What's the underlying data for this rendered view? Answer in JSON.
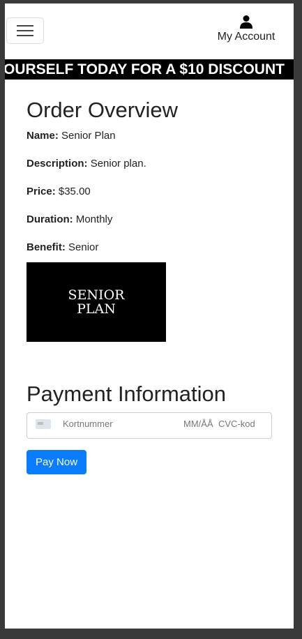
{
  "header": {
    "account_label": "My Account",
    "ticker_text": "OURSELF TODAY FOR A $10 DISCOUNT"
  },
  "order": {
    "title": "Order Overview",
    "fields": [
      {
        "label": "Name:",
        "value": "Senior Plan"
      },
      {
        "label": "Description:",
        "value": "Senior plan."
      },
      {
        "label": "Price:",
        "value": "$35.00"
      },
      {
        "label": "Duration:",
        "value": "Monthly"
      },
      {
        "label": "Benefit:",
        "value": "Senior"
      }
    ],
    "image_text_line1": "SENIOR",
    "image_text_line2": "PLAN"
  },
  "payment": {
    "title": "Payment Information",
    "card_number_placeholder": "Kortnummer",
    "expiry_placeholder": "MM/ÅÅ",
    "cvc_placeholder": "CVC-kod",
    "pay_button": "Pay Now"
  },
  "icons": {
    "menu": "hamburger-icon",
    "account": "user-icon",
    "card": "credit-card-icon"
  }
}
